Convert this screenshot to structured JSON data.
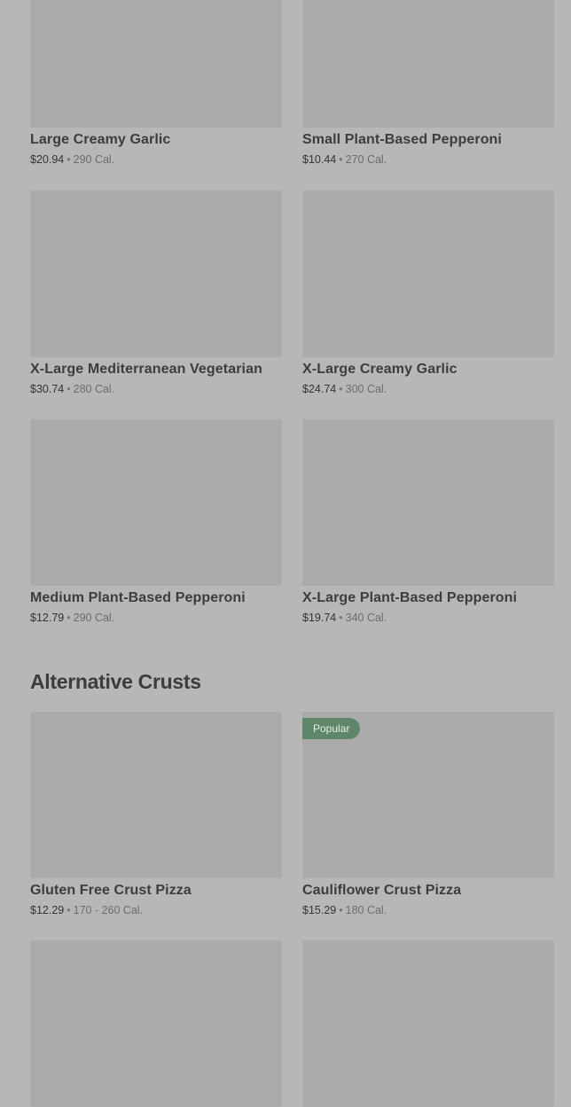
{
  "row1": [
    {
      "name": "Large Creamy Garlic",
      "price": "$20.94",
      "sep": "•",
      "cal": "290 Cal."
    },
    {
      "name": "Small Plant-Based Pepperoni",
      "price": "$10.44",
      "sep": "•",
      "cal": "270 Cal."
    }
  ],
  "row2": [
    {
      "name": "X-Large Mediterranean Vegetarian",
      "price": "$30.74",
      "sep": "•",
      "cal": "280 Cal."
    },
    {
      "name": "X-Large Creamy Garlic",
      "price": "$24.74",
      "sep": "•",
      "cal": "300 Cal."
    }
  ],
  "row3": [
    {
      "name": "Medium Plant-Based Pepperoni",
      "price": "$12.79",
      "sep": "•",
      "cal": "290 Cal."
    },
    {
      "name": "X-Large Plant-Based Pepperoni",
      "price": "$19.74",
      "sep": "•",
      "cal": "340 Cal."
    }
  ],
  "section": {
    "title": "Alternative Crusts"
  },
  "row4": [
    {
      "name": "Gluten Free Crust Pizza",
      "price": "$12.29",
      "sep": "•",
      "cal": "170 - 260 Cal."
    },
    {
      "name": "Cauliflower Crust Pizza",
      "price": "$15.29",
      "sep": "•",
      "cal": "180 Cal.",
      "badge": "Popular"
    }
  ],
  "colors": {
    "badge_bg": "#5f8668",
    "thumb_bg": "#ababab",
    "page_bg": "#b7b7b7"
  }
}
